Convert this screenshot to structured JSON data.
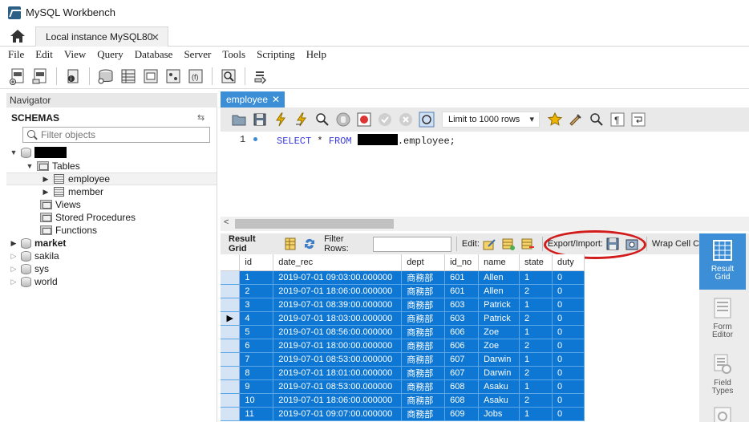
{
  "window": {
    "title": "MySQL Workbench"
  },
  "tabs": {
    "connection_tab": "Local instance MySQL80",
    "close_glyph": "✕"
  },
  "menu": [
    "File",
    "Edit",
    "View",
    "Query",
    "Database",
    "Server",
    "Tools",
    "Scripting",
    "Help"
  ],
  "navigator": {
    "header": "Navigator",
    "schemas_label": "SCHEMAS",
    "filter_placeholder": "Filter objects",
    "tree": {
      "tables_label": "Tables",
      "tables": [
        "employee",
        "member"
      ],
      "views_label": "Views",
      "procedures_label": "Stored Procedures",
      "functions_label": "Functions",
      "schemas": [
        "market",
        "sakila",
        "sys",
        "world"
      ]
    }
  },
  "editor": {
    "tab_label": "employee",
    "limit_label": "Limit to 1000 rows",
    "line_number": "1",
    "sql_kw_select": "SELECT",
    "sql_star": "*",
    "sql_kw_from": "FROM",
    "sql_table": ".employee;"
  },
  "result": {
    "result_grid_label": "Result Grid",
    "filter_rows_label": "Filter Rows:",
    "edit_label": "Edit:",
    "export_import_label": "Export/Import:",
    "wrap_label": "Wrap Cell C",
    "columns": [
      "id",
      "date_rec",
      "dept",
      "id_no",
      "name",
      "state",
      "duty"
    ],
    "rows": [
      [
        "1",
        "2019-07-01 09:03:00.000000",
        "商務部",
        "601",
        "Allen",
        "1",
        "0"
      ],
      [
        "2",
        "2019-07-01 18:06:00.000000",
        "商務部",
        "601",
        "Allen",
        "2",
        "0"
      ],
      [
        "3",
        "2019-07-01 08:39:00.000000",
        "商務部",
        "603",
        "Patrick",
        "1",
        "0"
      ],
      [
        "4",
        "2019-07-01 18:03:00.000000",
        "商務部",
        "603",
        "Patrick",
        "2",
        "0"
      ],
      [
        "5",
        "2019-07-01 08:56:00.000000",
        "商務部",
        "606",
        "Zoe",
        "1",
        "0"
      ],
      [
        "6",
        "2019-07-01 18:00:00.000000",
        "商務部",
        "606",
        "Zoe",
        "2",
        "0"
      ],
      [
        "7",
        "2019-07-01 08:53:00.000000",
        "商務部",
        "607",
        "Darwin",
        "1",
        "0"
      ],
      [
        "8",
        "2019-07-01 18:01:00.000000",
        "商務部",
        "607",
        "Darwin",
        "2",
        "0"
      ],
      [
        "9",
        "2019-07-01 08:53:00.000000",
        "商務部",
        "608",
        "Asaku",
        "1",
        "0"
      ],
      [
        "10",
        "2019-07-01 18:06:00.000000",
        "商務部",
        "608",
        "Asaku",
        "2",
        "0"
      ],
      [
        "11",
        "2019-07-01 09:07:00.000000",
        "商務部",
        "609",
        "Jobs",
        "1",
        "0"
      ]
    ]
  },
  "side_panel": {
    "result_grid": [
      "Result",
      "Grid"
    ],
    "form_editor": [
      "Form",
      "Editor"
    ],
    "field_types": [
      "Field",
      "Types"
    ]
  },
  "colors": {
    "accent": "#3c8fd6",
    "selection": "#0d77d3",
    "annotation": "#d21c1c"
  },
  "icons": [
    "home-icon",
    "new-sql-tab-icon",
    "open-sql-script-icon",
    "inspector-icon",
    "create-schema-icon",
    "create-table-icon",
    "create-view-icon",
    "create-procedure-icon",
    "create-function-icon",
    "search-table-icon",
    "reconnect-icon"
  ]
}
